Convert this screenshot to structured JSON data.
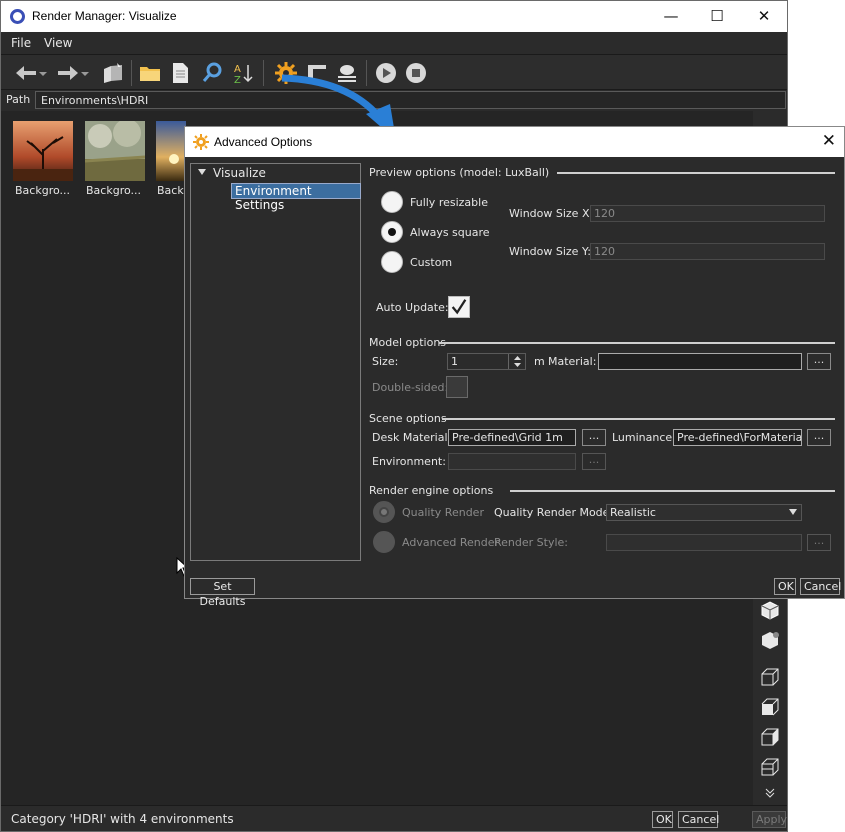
{
  "main": {
    "title": "Render Manager: Visualize",
    "menu": [
      "File",
      "View"
    ],
    "path_label": "Path",
    "path_value": "Environments\\HDRI",
    "thumbnails": [
      "Backgro...",
      "Backgro...",
      "Backg"
    ],
    "status": "Category 'HDRI' with 4 environments",
    "ok": "OK",
    "cancel": "Cancel",
    "apply": "Apply",
    "window_controls": {
      "minimize": "—",
      "maximize": "☐",
      "close": "✕"
    }
  },
  "dialog": {
    "title": "Advanced Options",
    "close": "✕",
    "tree": {
      "root": "Visualize",
      "child": "Environment Settings"
    },
    "preview": {
      "header": "Preview options (model: LuxBall)",
      "fully_resizable": "Fully resizable",
      "always_square": "Always square",
      "custom": "Custom",
      "selected": "Always square",
      "window_x_label": "Window Size X:",
      "window_x": "120",
      "window_y_label": "Window Size Y:",
      "window_y": "120",
      "auto_update_label": "Auto Update:",
      "auto_update": true
    },
    "model": {
      "header": "Model options",
      "size_label": "Size:",
      "size": "1",
      "size_unit": "m",
      "material_label": "Material:",
      "material": "",
      "double_sided_label": "Double-sided:"
    },
    "scene": {
      "header": "Scene options",
      "desk_label": "Desk Material:",
      "desk": "Pre-defined\\Grid 1m",
      "luminance_label": "Luminance:",
      "luminance": "Pre-defined\\ForMaterials\\",
      "environment_label": "Environment:",
      "environment": ""
    },
    "render": {
      "header": "Render engine options",
      "quality_render": "Quality Render",
      "advanced_render": "Advanced Render",
      "mode_label": "Quality Render Mode:",
      "mode": "Realistic",
      "style_label": "Render Style:",
      "style": ""
    },
    "ellipsis": "...",
    "set_defaults": "Set Defaults",
    "ok": "OK",
    "cancel": "Cancel"
  },
  "colors": {
    "accent": "#3c6ea0",
    "gear": "#f0a020",
    "arrow": "#2a7fd6"
  }
}
